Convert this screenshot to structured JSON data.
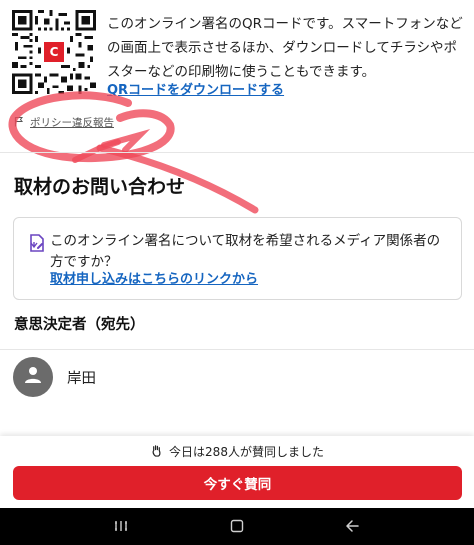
{
  "qr_section": {
    "description": "このオンライン署名のQRコードです。スマートフォンなどの画面上で表示させるほか、ダウンロードしてチラシやポスターなどの印刷物に使うこともできます。",
    "download_link": "QRコードをダウンロードする",
    "report_link": "ポリシー違反報告",
    "qr_badge": "C"
  },
  "media": {
    "title": "取材のお問い合わせ",
    "card_text": "このオンライン署名について取材を希望されるメディア関係者の方ですか？",
    "card_link": "取材申し込みはこちらのリンクから"
  },
  "decision_makers": {
    "title": "意思決定者（宛先）",
    "items": [
      {
        "name": "岸田"
      }
    ]
  },
  "bottom": {
    "counter_text": "今日は288人が賛同しました",
    "sign_button": "今すぐ賛同"
  },
  "icons": {
    "flag": "flag-icon",
    "media": "media-request-icon",
    "avatar": "person-icon",
    "hand": "raised-hand-icon",
    "nav_recent": "recent-apps-icon",
    "nav_home": "home-icon",
    "nav_back": "back-icon"
  },
  "colors": {
    "accent_red": "#e0202a",
    "link_blue": "#1565c0",
    "annotation": "#ef4a5a",
    "nav_bar": "#000000"
  }
}
